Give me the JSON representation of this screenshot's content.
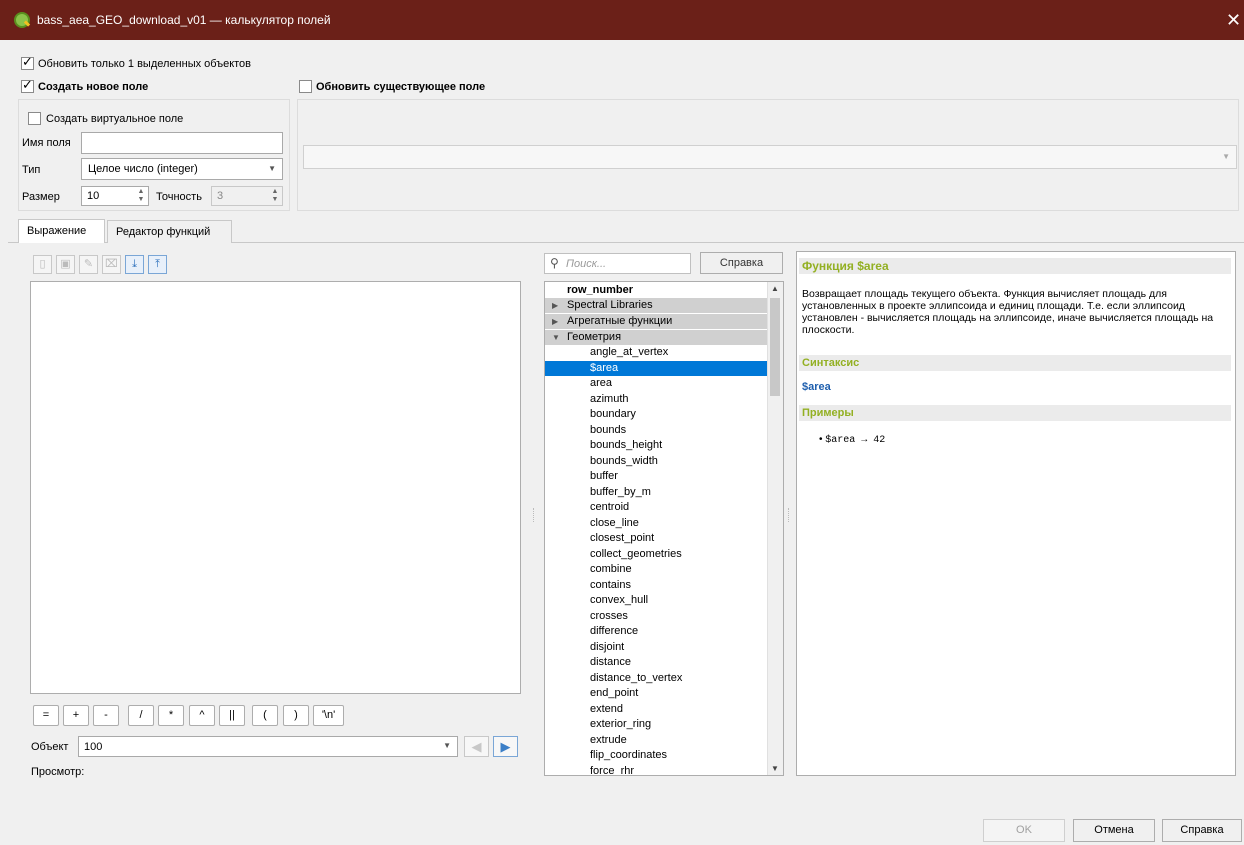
{
  "window": {
    "title": "bass_aea_GEO_download_v01 — калькулятор полей",
    "close_glyph": "✕"
  },
  "options": {
    "update_selected_only": "Обновить только 1 выделенных объектов",
    "create_new_field": "Создать новое поле",
    "update_existing_field": "Обновить существующее поле"
  },
  "new_field": {
    "virtual_label": "Создать виртуальное поле",
    "name_label": "Имя поля",
    "name_value": "",
    "type_label": "Тип",
    "type_value": "Целое число (integer)",
    "size_label": "Размер",
    "size_value": "10",
    "precision_label": "Точность",
    "precision_value": "3"
  },
  "tabs": [
    "Выражение",
    "Редактор функций"
  ],
  "operators": [
    "=",
    "+",
    "-",
    "/",
    "*",
    "^",
    "||",
    "(",
    ")",
    "'\\n'"
  ],
  "feature": {
    "label": "Объект",
    "value": "100",
    "preview_label": "Просмотр:"
  },
  "search": {
    "placeholder": "Поиск...",
    "help_button": "Справка"
  },
  "tree": {
    "top_item": "row_number",
    "groups": [
      "Spectral Libraries",
      "Агрегатные функции",
      "Геометрия"
    ],
    "items": [
      "angle_at_vertex",
      "$area",
      "area",
      "azimuth",
      "boundary",
      "bounds",
      "bounds_height",
      "bounds_width",
      "buffer",
      "buffer_by_m",
      "centroid",
      "close_line",
      "closest_point",
      "collect_geometries",
      "combine",
      "contains",
      "convex_hull",
      "crosses",
      "difference",
      "disjoint",
      "distance",
      "distance_to_vertex",
      "end_point",
      "extend",
      "exterior_ring",
      "extrude",
      "flip_coordinates",
      "force_rhr"
    ],
    "selected_index": 1
  },
  "help": {
    "title": "Функция $area",
    "description": "Возвращает площадь текущего объекта. Функция вычисляет площадь для установленных в проекте эллипсоида и единиц площади. Т.е. если эллипсоид установлен - вычисляется площадь на эллипсоиде, иначе вычисляется площадь на плоскости.",
    "syntax_header": "Синтаксис",
    "syntax": "$area",
    "examples_header": "Примеры",
    "example": "$area → 42"
  },
  "buttons": {
    "ok": "OK",
    "cancel": "Отмена",
    "help": "Справка"
  },
  "colors": {
    "titlebar": "#6b2018",
    "selection": "#0078d7",
    "help_header": "#93b023",
    "syntax_link": "#1f5fae"
  }
}
